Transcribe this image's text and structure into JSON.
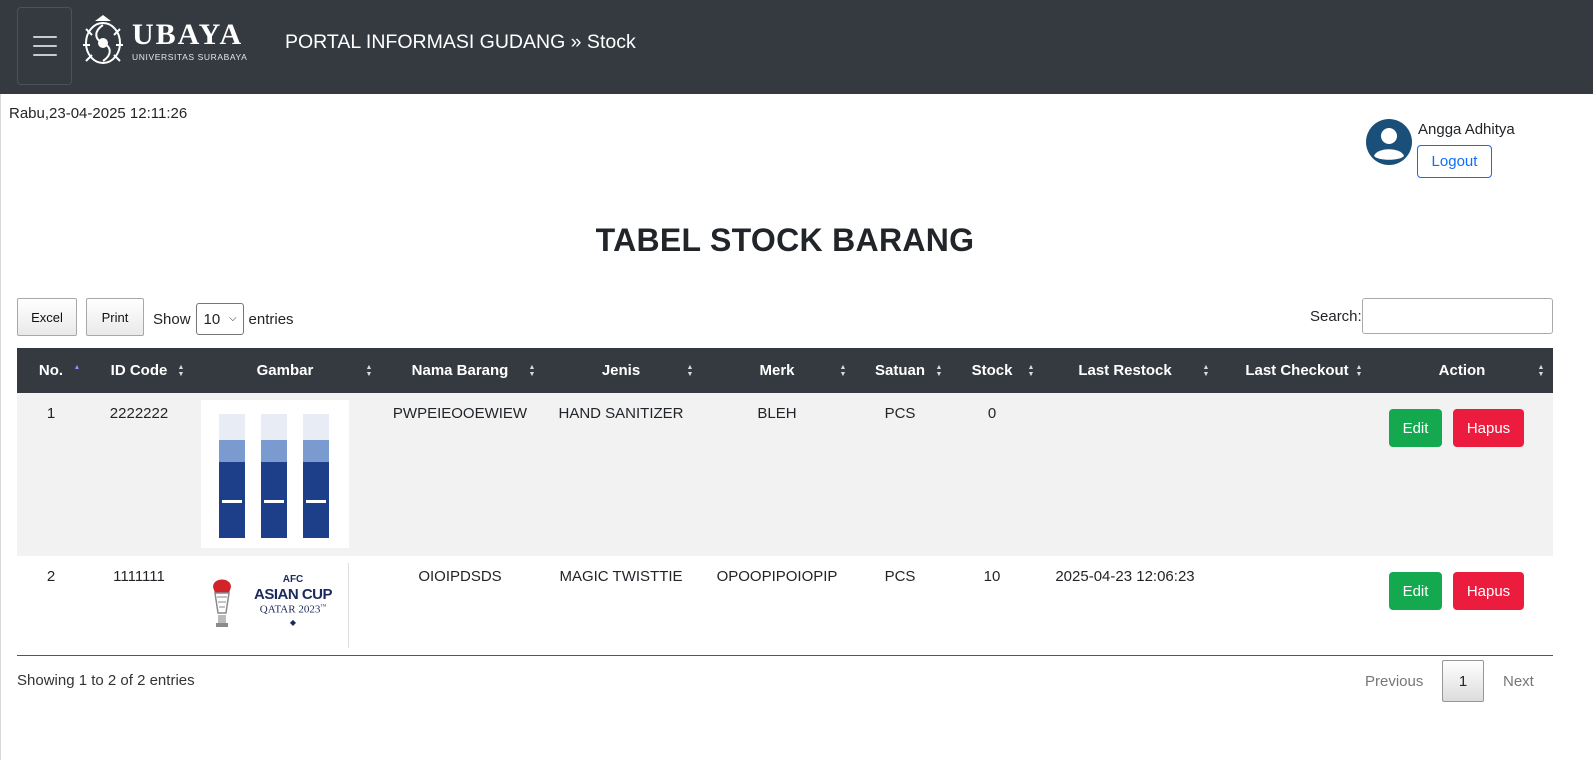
{
  "header": {
    "logo_text": "UBAYA",
    "logo_subtext": "UNIVERSITAS SURABAYA",
    "brand": "PORTAL INFORMASI GUDANG » Stock",
    "bg_color": "#343a40"
  },
  "datetime": "Rabu,23-04-2025 12:11:26",
  "user": {
    "name": "Angga Adhitya",
    "logout_label": "Logout",
    "avatar_color": "#1a4f7a"
  },
  "page_title": "TABEL STOCK BARANG",
  "controls": {
    "excel_label": "Excel",
    "print_label": "Print",
    "show_label": "Show",
    "entries_value": "10",
    "entries_label": "entries",
    "search_label": "Search:",
    "search_value": ""
  },
  "table": {
    "columns": [
      "No.",
      "ID Code",
      "Gambar",
      "Nama Barang",
      "Jenis",
      "Merk",
      "Satuan",
      "Stock",
      "Last Restock",
      "Last Checkout",
      "Action"
    ],
    "rows": [
      {
        "no": "1",
        "id_code": "2222222",
        "image": "epson-ribbon-cartridges-image",
        "nama_barang": "PWPEIEOOEWIEW",
        "jenis": "HAND SANITIZER",
        "merk": "BLEH",
        "satuan": "PCS",
        "stock": "0",
        "last_restock": "",
        "last_checkout": "",
        "edit_label": "Edit",
        "hapus_label": "Hapus"
      },
      {
        "no": "2",
        "id_code": "1111111",
        "image": "afc-asian-cup-logo-image",
        "image_text": [
          "AFC",
          "ASIAN CUP",
          "QATAR 2023"
        ],
        "nama_barang": "OIOIPDSDS",
        "jenis": "MAGIC TWISTTIE",
        "merk": "OPOOPIPOIOPIP",
        "satuan": "PCS",
        "stock": "10",
        "last_restock": "2025-04-23 12:06:23",
        "last_checkout": "",
        "edit_label": "Edit",
        "hapus_label": "Hapus"
      }
    ]
  },
  "footer": {
    "info": "Showing 1 to 2 of 2 entries",
    "previous_label": "Previous",
    "page": "1",
    "next_label": "Next"
  },
  "colors": {
    "edit": "#14a84f",
    "hapus": "#ec1c3e",
    "logout": "#0d6efd"
  }
}
